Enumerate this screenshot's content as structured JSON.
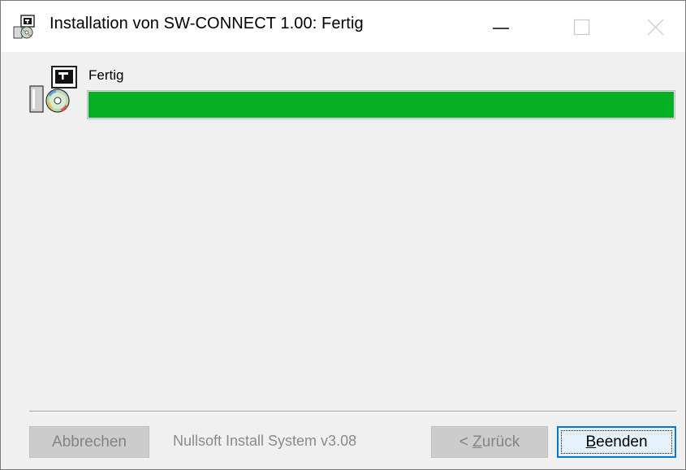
{
  "window": {
    "title": "Installation von SW-CONNECT 1.00: Fertig",
    "app_icon": "installer-icon"
  },
  "title_buttons": {
    "minimize_icon": "minimize-icon",
    "maximize_icon": "maximize-icon",
    "close_icon": "close-icon"
  },
  "main": {
    "setup_icon": "setup-cd-icon",
    "status_label": "Fertig",
    "progress_fraction": 1.0
  },
  "footer": {
    "cancel_label": "Abbrechen",
    "cancel_enabled": false,
    "branding": "Nullsoft Install System v3.08",
    "back_label_prefix": "< ",
    "back_label_underlined": "Z",
    "back_label_rest": "urück",
    "back_enabled": false,
    "finish_label_underlined": "B",
    "finish_label_rest": "eenden",
    "finish_enabled": true
  },
  "colors": {
    "progress_fill": "#06b025",
    "window_bg": "#f0f0f0",
    "focus_border": "#0078d7"
  }
}
